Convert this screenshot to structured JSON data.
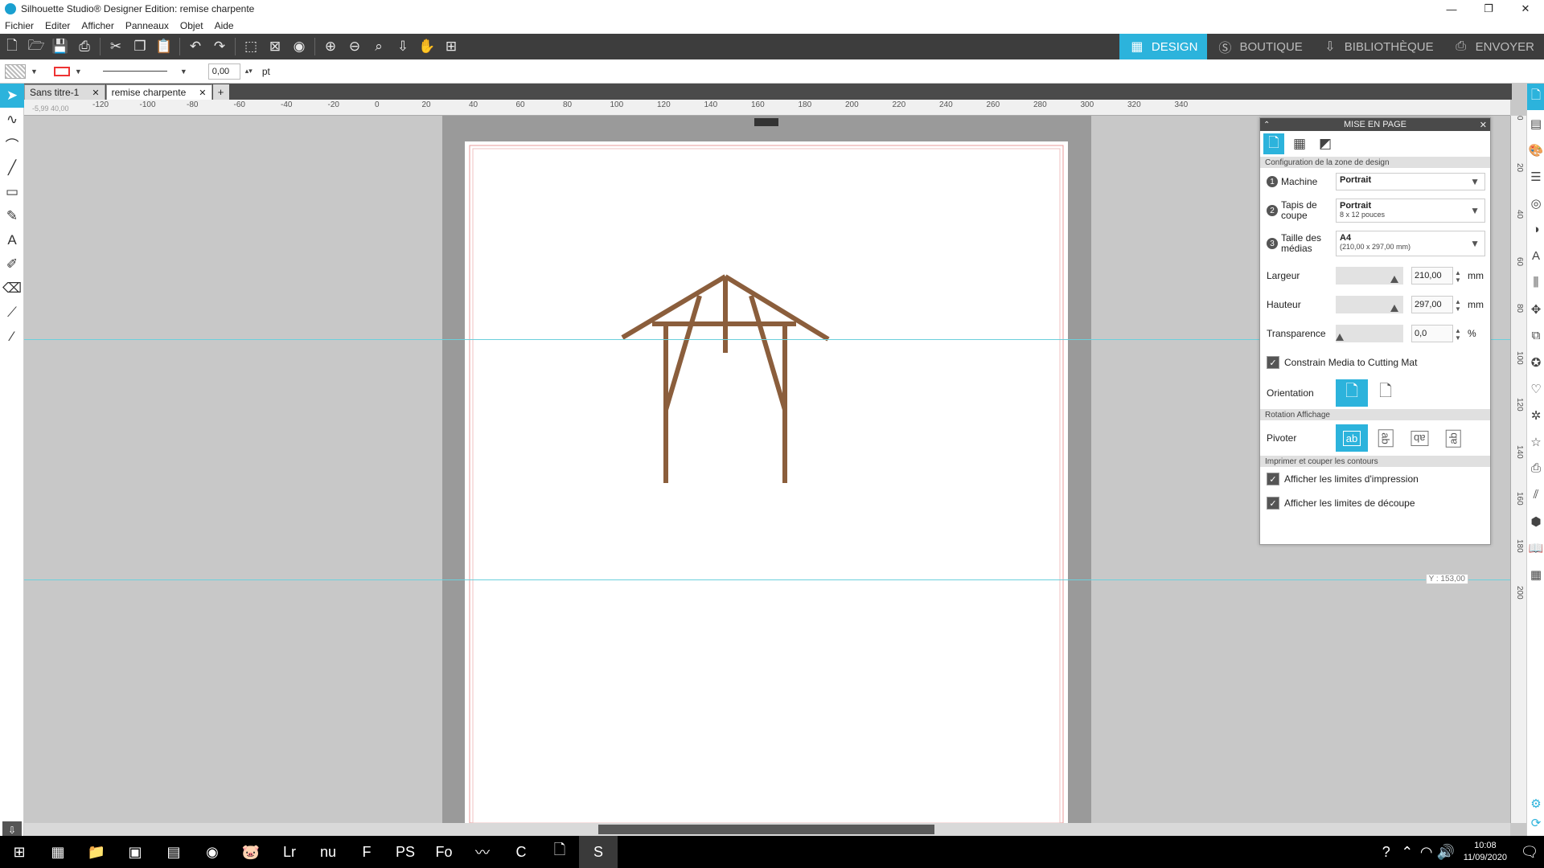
{
  "window": {
    "title": "Silhouette Studio® Designer Edition: remise charpente",
    "controls": [
      "—",
      "❐",
      "✕"
    ]
  },
  "menu": [
    "Fichier",
    "Editer",
    "Afficher",
    "Panneaux",
    "Objet",
    "Aide"
  ],
  "toolbar": {
    "icons": [
      "new-file-icon",
      "open-folder-icon",
      "save-icon",
      "print-icon",
      "cut-icon",
      "copy-icon",
      "paste-icon",
      "undo-icon",
      "redo-icon",
      "select-all-icon",
      "deselect-icon",
      "select-by-color-icon",
      "zoom-in-icon",
      "zoom-out-icon",
      "zoom-selection-icon",
      "pan-down-icon",
      "hand-icon",
      "fit-page-icon"
    ],
    "modes": [
      {
        "label": "DESIGN",
        "icon": "grid-icon",
        "active": true
      },
      {
        "label": "BOUTIQUE",
        "icon": "store-icon",
        "active": false
      },
      {
        "label": "BIBLIOTHÈQUE",
        "icon": "library-icon",
        "active": false
      },
      {
        "label": "ENVOYER",
        "icon": "send-icon",
        "active": false
      }
    ]
  },
  "line_props": {
    "width_value": "0,00",
    "unit": "pt"
  },
  "tabs": [
    {
      "label": "Sans titre-1",
      "active": false
    },
    {
      "label": "remise charpente",
      "active": true
    }
  ],
  "ruler": {
    "h_ticks": [
      "-120",
      "-100",
      "-80",
      "-60",
      "-40",
      "-20",
      "0",
      "20",
      "40",
      "60",
      "80",
      "100",
      "120",
      "140",
      "160",
      "180",
      "200",
      "220",
      "240",
      "260",
      "280",
      "300",
      "320",
      "340"
    ],
    "v_ticks": [
      "0",
      "20",
      "40",
      "60",
      "80",
      "100",
      "120",
      "140",
      "160",
      "180",
      "200"
    ],
    "cursor_readout": "-5,99  40,00"
  },
  "guide_readout": "Y : 153,00",
  "panel": {
    "title": "MISE EN PAGE",
    "section_design_area": "Configuration de la zone de design",
    "machine_label": "Machine",
    "machine_value": "Portrait",
    "mat_label": "Tapis de coupe",
    "mat_value": "Portrait",
    "mat_sub": "8 x 12 pouces",
    "media_label": "Taille des médias",
    "media_value": "A4",
    "media_sub": "(210,00 x 297,00 mm)",
    "width_label": "Largeur",
    "width_value": "210,00",
    "height_label": "Hauteur",
    "height_value": "297,00",
    "unit_mm": "mm",
    "transparency_label": "Transparence",
    "transparency_value": "0,0",
    "unit_pct": "%",
    "constrain_label": "Constrain Media to Cutting Mat",
    "constrain_checked": true,
    "orientation_label": "Orientation",
    "section_rotation": "Rotation Affichage",
    "rotate_label": "Pivoter",
    "rotate_options": [
      "ab",
      "ab",
      "ab",
      "ab"
    ],
    "section_print": "Imprimer et couper les contours",
    "print_bounds_label": "Afficher les limites d'impression",
    "cut_bounds_label": "Afficher les limites de découpe",
    "transparency_level": 0.0,
    "width_slider_level": 0.85,
    "height_slider_level": 0.85
  },
  "design": {
    "stroke_color": "#8b5e3c"
  },
  "taskbar": {
    "apps": [
      "windows-start-icon",
      "calculator-icon",
      "file-explorer-icon",
      "photo-app-icon",
      "notes-app-icon",
      "firefox-icon",
      "pig-app-icon",
      "lightroom-icon",
      "nu-app-icon",
      "f-app-icon",
      "pse-app-icon",
      "fontlab-icon",
      "wave-app-icon",
      "cyan-app-icon",
      "document-icon",
      "silhouette-icon"
    ],
    "time": "10:08",
    "date": "11/09/2020"
  },
  "colors": {
    "accent": "#2cb3dc",
    "toolbar": "#3d3d3d",
    "guide": "#6cd0dc",
    "print_bound": "#e88"
  }
}
